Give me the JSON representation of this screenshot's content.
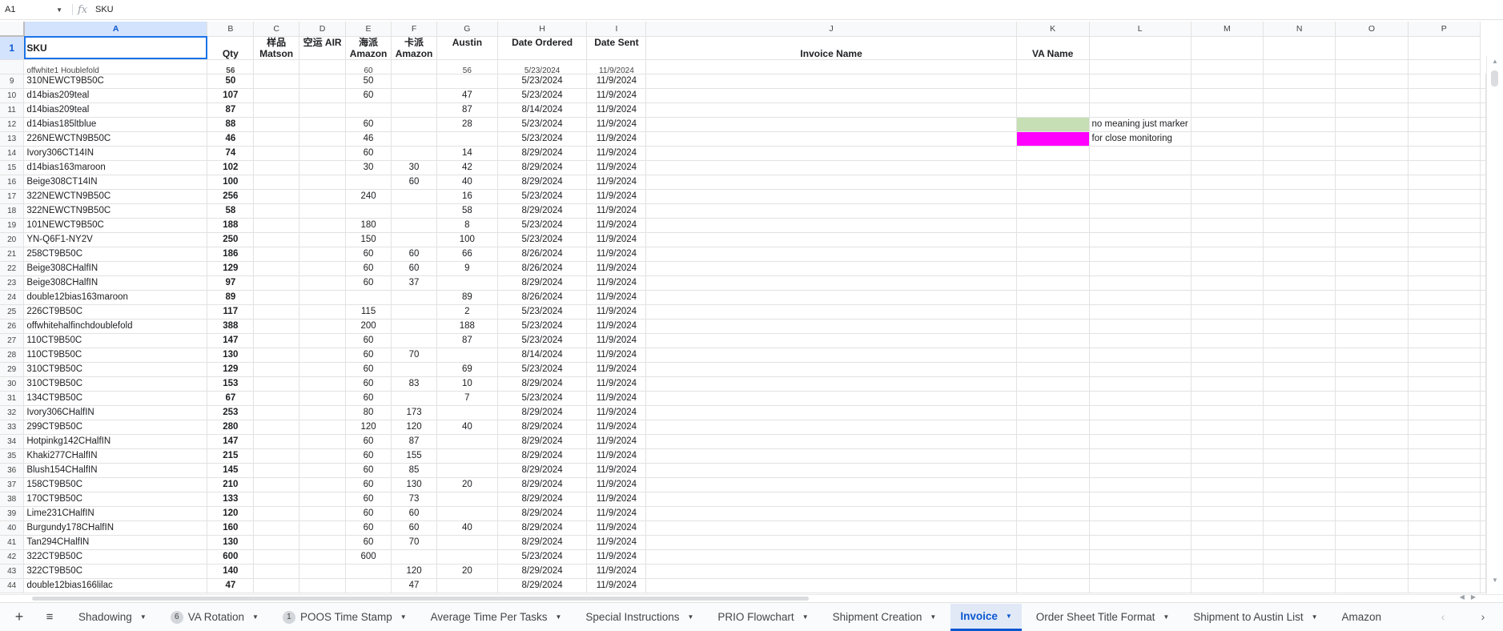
{
  "formula_bar": {
    "name_box": "A1",
    "fx_icon": "fx",
    "content": "SKU"
  },
  "columns": [
    "A",
    "B",
    "C",
    "D",
    "E",
    "F",
    "G",
    "H",
    "I",
    "J",
    "K",
    "L",
    "M",
    "N",
    "O",
    "P"
  ],
  "header_row": {
    "row_num": "1",
    "sku": "SKU",
    "qty": "Qty",
    "c1": "样品",
    "c2": "Matson",
    "d1": "空运 AIR",
    "e1": "海派",
    "e2": "Amazon",
    "f1": "卡派",
    "f2": "Amazon",
    "austin": "Austin",
    "date_ordered": "Date Ordered",
    "date_sent": "Date Sent",
    "invoice_name": "Invoice Name",
    "va_name": "VA Name"
  },
  "partial_row": {
    "sku": "offwhite1 Houblefold",
    "qty": "56",
    "e": "60",
    "g": "56",
    "h": "5/23/2024",
    "i": "11/9/2024"
  },
  "rows": [
    {
      "n": "9",
      "sku": "310NEWCT9B50C",
      "qty": "50",
      "c": "",
      "d": "",
      "e": "50",
      "f": "",
      "g": "",
      "h": "5/23/2024",
      "i": "11/9/2024"
    },
    {
      "n": "10",
      "sku": "d14bias209teal",
      "qty": "107",
      "c": "",
      "d": "",
      "e": "60",
      "f": "",
      "g": "47",
      "h": "5/23/2024",
      "i": "11/9/2024"
    },
    {
      "n": "11",
      "sku": "d14bias209teal",
      "qty": "87",
      "c": "",
      "d": "",
      "e": "",
      "f": "",
      "g": "87",
      "h": "8/14/2024",
      "i": "11/9/2024"
    },
    {
      "n": "12",
      "sku": "d14bias185ltblue",
      "qty": "88",
      "c": "",
      "d": "",
      "e": "60",
      "f": "",
      "g": "28",
      "h": "5/23/2024",
      "i": "11/9/2024"
    },
    {
      "n": "13",
      "sku": "226NEWCTN9B50C",
      "qty": "46",
      "c": "",
      "d": "",
      "e": "46",
      "f": "",
      "g": "",
      "h": "5/23/2024",
      "i": "11/9/2024"
    },
    {
      "n": "14",
      "sku": "Ivory306CT14IN",
      "qty": "74",
      "c": "",
      "d": "",
      "e": "60",
      "f": "",
      "g": "14",
      "h": "8/29/2024",
      "i": "11/9/2024"
    },
    {
      "n": "15",
      "sku": "d14bias163maroon",
      "qty": "102",
      "c": "",
      "d": "",
      "e": "30",
      "f": "30",
      "g": "42",
      "h": "8/29/2024",
      "i": "11/9/2024"
    },
    {
      "n": "16",
      "sku": "Beige308CT14IN",
      "qty": "100",
      "c": "",
      "d": "",
      "e": "",
      "f": "60",
      "g": "40",
      "h": "8/29/2024",
      "i": "11/9/2024"
    },
    {
      "n": "17",
      "sku": "322NEWCTN9B50C",
      "qty": "256",
      "c": "",
      "d": "",
      "e": "240",
      "f": "",
      "g": "16",
      "h": "5/23/2024",
      "i": "11/9/2024"
    },
    {
      "n": "18",
      "sku": "322NEWCTN9B50C",
      "qty": "58",
      "c": "",
      "d": "",
      "e": "",
      "f": "",
      "g": "58",
      "h": "8/29/2024",
      "i": "11/9/2024"
    },
    {
      "n": "19",
      "sku": "101NEWCT9B50C",
      "qty": "188",
      "c": "",
      "d": "",
      "e": "180",
      "f": "",
      "g": "8",
      "h": "5/23/2024",
      "i": "11/9/2024"
    },
    {
      "n": "20",
      "sku": "YN-Q6F1-NY2V",
      "qty": "250",
      "c": "",
      "d": "",
      "e": "150",
      "f": "",
      "g": "100",
      "h": "5/23/2024",
      "i": "11/9/2024"
    },
    {
      "n": "21",
      "sku": "258CT9B50C",
      "qty": "186",
      "c": "",
      "d": "",
      "e": "60",
      "f": "60",
      "g": "66",
      "h": "8/26/2024",
      "i": "11/9/2024"
    },
    {
      "n": "22",
      "sku": "Beige308CHalfIN",
      "qty": "129",
      "c": "",
      "d": "",
      "e": "60",
      "f": "60",
      "g": "9",
      "h": "8/26/2024",
      "i": "11/9/2024"
    },
    {
      "n": "23",
      "sku": "Beige308CHalfIN",
      "qty": "97",
      "c": "",
      "d": "",
      "e": "60",
      "f": "37",
      "g": "",
      "h": "8/29/2024",
      "i": "11/9/2024"
    },
    {
      "n": "24",
      "sku": "double12bias163maroon",
      "qty": "89",
      "c": "",
      "d": "",
      "e": "",
      "f": "",
      "g": "89",
      "h": "8/26/2024",
      "i": "11/9/2024"
    },
    {
      "n": "25",
      "sku": "226CT9B50C",
      "qty": "117",
      "c": "",
      "d": "",
      "e": "115",
      "f": "",
      "g": "2",
      "h": "5/23/2024",
      "i": "11/9/2024"
    },
    {
      "n": "26",
      "sku": "offwhitehalfinchdoublefold",
      "qty": "388",
      "c": "",
      "d": "",
      "e": "200",
      "f": "",
      "g": "188",
      "h": "5/23/2024",
      "i": "11/9/2024"
    },
    {
      "n": "27",
      "sku": "110CT9B50C",
      "qty": "147",
      "c": "",
      "d": "",
      "e": "60",
      "f": "",
      "g": "87",
      "h": "5/23/2024",
      "i": "11/9/2024"
    },
    {
      "n": "28",
      "sku": "110CT9B50C",
      "qty": "130",
      "c": "",
      "d": "",
      "e": "60",
      "f": "70",
      "g": "",
      "h": "8/14/2024",
      "i": "11/9/2024"
    },
    {
      "n": "29",
      "sku": "310CT9B50C",
      "qty": "129",
      "c": "",
      "d": "",
      "e": "60",
      "f": "",
      "g": "69",
      "h": "5/23/2024",
      "i": "11/9/2024"
    },
    {
      "n": "30",
      "sku": "310CT9B50C",
      "qty": "153",
      "c": "",
      "d": "",
      "e": "60",
      "f": "83",
      "g": "10",
      "h": "8/29/2024",
      "i": "11/9/2024"
    },
    {
      "n": "31",
      "sku": "134CT9B50C",
      "qty": "67",
      "c": "",
      "d": "",
      "e": "60",
      "f": "",
      "g": "7",
      "h": "5/23/2024",
      "i": "11/9/2024"
    },
    {
      "n": "32",
      "sku": "Ivory306CHalfIN",
      "qty": "253",
      "c": "",
      "d": "",
      "e": "80",
      "f": "173",
      "g": "",
      "h": "8/29/2024",
      "i": "11/9/2024"
    },
    {
      "n": "33",
      "sku": "299CT9B50C",
      "qty": "280",
      "c": "",
      "d": "",
      "e": "120",
      "f": "120",
      "g": "40",
      "h": "8/29/2024",
      "i": "11/9/2024"
    },
    {
      "n": "34",
      "sku": "Hotpinkg142CHalfIN",
      "qty": "147",
      "c": "",
      "d": "",
      "e": "60",
      "f": "87",
      "g": "",
      "h": "8/29/2024",
      "i": "11/9/2024"
    },
    {
      "n": "35",
      "sku": "Khaki277CHalfIN",
      "qty": "215",
      "c": "",
      "d": "",
      "e": "60",
      "f": "155",
      "g": "",
      "h": "8/29/2024",
      "i": "11/9/2024"
    },
    {
      "n": "36",
      "sku": "Blush154CHalfIN",
      "qty": "145",
      "c": "",
      "d": "",
      "e": "60",
      "f": "85",
      "g": "",
      "h": "8/29/2024",
      "i": "11/9/2024"
    },
    {
      "n": "37",
      "sku": "158CT9B50C",
      "qty": "210",
      "c": "",
      "d": "",
      "e": "60",
      "f": "130",
      "g": "20",
      "h": "8/29/2024",
      "i": "11/9/2024"
    },
    {
      "n": "38",
      "sku": "170CT9B50C",
      "qty": "133",
      "c": "",
      "d": "",
      "e": "60",
      "f": "73",
      "g": "",
      "h": "8/29/2024",
      "i": "11/9/2024"
    },
    {
      "n": "39",
      "sku": "Lime231CHalfIN",
      "qty": "120",
      "c": "",
      "d": "",
      "e": "60",
      "f": "60",
      "g": "",
      "h": "8/29/2024",
      "i": "11/9/2024"
    },
    {
      "n": "40",
      "sku": "Burgundy178CHalfIN",
      "qty": "160",
      "c": "",
      "d": "",
      "e": "60",
      "f": "60",
      "g": "40",
      "h": "8/29/2024",
      "i": "11/9/2024"
    },
    {
      "n": "41",
      "sku": "Tan294CHalfIN",
      "qty": "130",
      "c": "",
      "d": "",
      "e": "60",
      "f": "70",
      "g": "",
      "h": "8/29/2024",
      "i": "11/9/2024"
    },
    {
      "n": "42",
      "sku": "322CT9B50C",
      "qty": "600",
      "c": "",
      "d": "",
      "e": "600",
      "f": "",
      "g": "",
      "h": "5/23/2024",
      "i": "11/9/2024"
    },
    {
      "n": "43",
      "sku": "322CT9B50C",
      "qty": "140",
      "c": "",
      "d": "",
      "e": "",
      "f": "120",
      "g": "20",
      "h": "8/29/2024",
      "i": "11/9/2024"
    },
    {
      "n": "44",
      "sku": "double12bias166lilac",
      "qty": "47",
      "c": "",
      "d": "",
      "e": "",
      "f": "47",
      "g": "",
      "h": "8/29/2024",
      "i": "11/9/2024"
    }
  ],
  "legend": [
    {
      "row": "12",
      "color": "#c6dfb4",
      "label": "no meaning just marker"
    },
    {
      "row": "13",
      "color": "#ff00ff",
      "label": "for close monitoring"
    }
  ],
  "tabs": {
    "add_icon": "+",
    "all_sheets_icon": "≡",
    "items": [
      {
        "label": "Shadowing",
        "badge": ""
      },
      {
        "label": "VA Rotation",
        "badge": "6"
      },
      {
        "label": "POOS Time Stamp",
        "badge": "1"
      },
      {
        "label": "Average Time Per Tasks",
        "badge": ""
      },
      {
        "label": "Special Instructions",
        "badge": ""
      },
      {
        "label": "PRIO Flowchart",
        "badge": ""
      },
      {
        "label": "Shipment Creation",
        "badge": ""
      },
      {
        "label": "Invoice",
        "badge": "",
        "active": true
      },
      {
        "label": "Order Sheet Title Format",
        "badge": ""
      },
      {
        "label": "Shipment to Austin List",
        "badge": ""
      },
      {
        "label": "Amazon",
        "badge": ""
      }
    ],
    "prev_icon": "‹",
    "next_icon": "›"
  }
}
